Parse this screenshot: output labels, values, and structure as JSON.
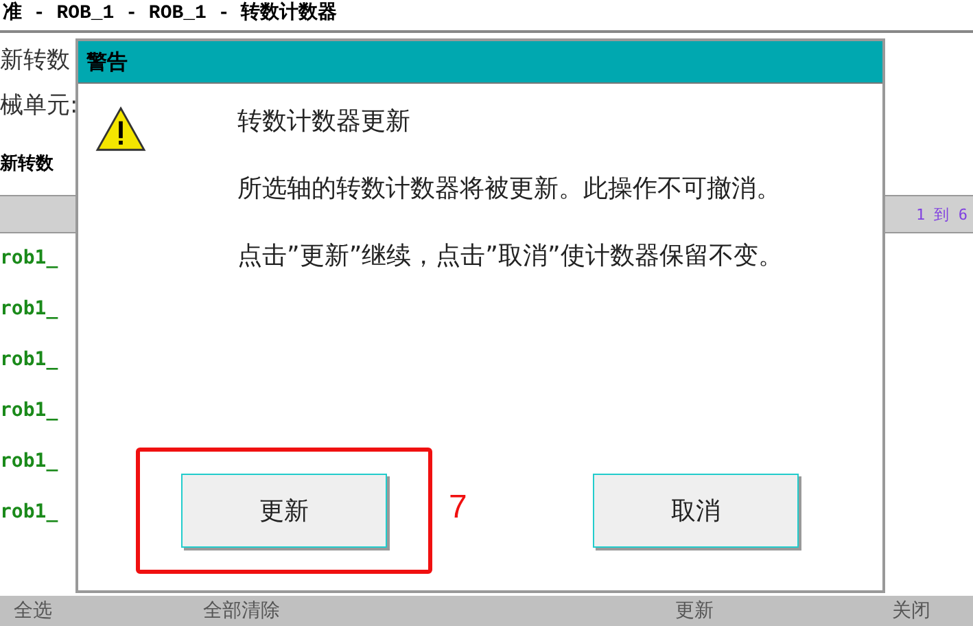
{
  "window": {
    "title": "准 - ROB_1 - ROB_1 - 转数计数器"
  },
  "background": {
    "heading": "新转数",
    "unit_label": "械单元:",
    "section_label": "新转数",
    "range": "1 到 6",
    "rows": [
      "rob1_",
      "rob1_",
      "rob1_",
      "rob1_",
      "rob1_",
      "rob1_"
    ],
    "buttons": [
      "全选",
      "全部清除",
      "更新",
      "关闭"
    ]
  },
  "dialog": {
    "title": "警告",
    "heading": "转数计数器更新",
    "message": "所选轴的转数计数器将被更新。此操作不可撤消。",
    "instruction": "点击”更新”继续，点击”取消”使计数器保留不变。",
    "buttons": [
      {
        "label": "更新",
        "highlighted": true
      },
      {
        "label": "取消",
        "highlighted": false
      }
    ]
  },
  "annotation": {
    "label": "7"
  }
}
